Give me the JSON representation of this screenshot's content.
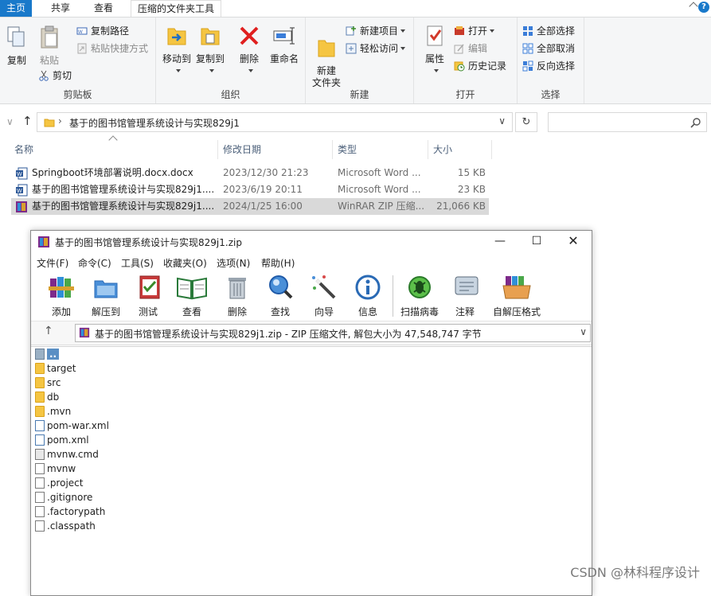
{
  "ribbon": {
    "tabs": [
      "主页",
      "共享",
      "查看",
      "压缩的文件夹工具"
    ],
    "groups": {
      "clipboard": {
        "label": "剪贴板",
        "copy": "复制",
        "paste": "粘贴",
        "copy_path": "复制路径",
        "paste_shortcut": "粘贴快捷方式",
        "cut": "剪切"
      },
      "organize": {
        "label": "组织",
        "move_to": "移动到",
        "copy_to": "复制到",
        "delete": "删除",
        "rename": "重命名"
      },
      "new": {
        "label": "新建",
        "new_folder": "新建\n文件夹",
        "new_item": "新建项目",
        "easy_access": "轻松访问"
      },
      "open": {
        "label": "打开",
        "properties": "属性",
        "open": "打开",
        "edit": "编辑",
        "history": "历史记录"
      },
      "select": {
        "label": "选择",
        "select_all": "全部选择",
        "select_none": "全部取消",
        "invert": "反向选择"
      }
    }
  },
  "address": {
    "path": "基于的图书馆管理系统设计与实现829j1"
  },
  "file_list": {
    "columns": [
      "名称",
      "修改日期",
      "类型",
      "大小"
    ],
    "rows": [
      {
        "name": "Springboot环境部署说明.docx.docx",
        "date": "2023/12/30 21:23",
        "type": "Microsoft Word ...",
        "size": "15 KB"
      },
      {
        "name": "基于的图书馆管理系统设计与实现829j1....",
        "date": "2023/6/19 20:11",
        "type": "Microsoft Word ...",
        "size": "23 KB"
      },
      {
        "name": "基于的图书馆管理系统设计与实现829j1....",
        "date": "2024/1/25 16:00",
        "type": "WinRAR ZIP 压缩...",
        "size": "21,066 KB"
      }
    ]
  },
  "winrar": {
    "title": "基于的图书馆管理系统设计与实现829j1.zip",
    "menus": [
      "文件(F)",
      "命令(C)",
      "工具(S)",
      "收藏夹(O)",
      "选项(N)",
      "帮助(H)"
    ],
    "toolbar": [
      "添加",
      "解压到",
      "测试",
      "查看",
      "删除",
      "查找",
      "向导",
      "信息",
      "扫描病毒",
      "注释",
      "自解压格式"
    ],
    "path": "基于的图书馆管理系统设计与实现829j1.zip - ZIP 压缩文件, 解包大小为 47,548,747 字节",
    "items": [
      {
        "name": "..",
        "kind": "up"
      },
      {
        "name": "target",
        "kind": "folder"
      },
      {
        "name": "src",
        "kind": "folder"
      },
      {
        "name": "db",
        "kind": "folder"
      },
      {
        "name": ".mvn",
        "kind": "folder"
      },
      {
        "name": "pom-war.xml",
        "kind": "xml"
      },
      {
        "name": "pom.xml",
        "kind": "xml"
      },
      {
        "name": "mvnw.cmd",
        "kind": "cmd"
      },
      {
        "name": "mvnw",
        "kind": "file"
      },
      {
        "name": ".project",
        "kind": "file"
      },
      {
        "name": ".gitignore",
        "kind": "file"
      },
      {
        "name": ".factorypath",
        "kind": "file"
      },
      {
        "name": ".classpath",
        "kind": "file"
      }
    ]
  },
  "watermark": "CSDN @林科程序设计"
}
